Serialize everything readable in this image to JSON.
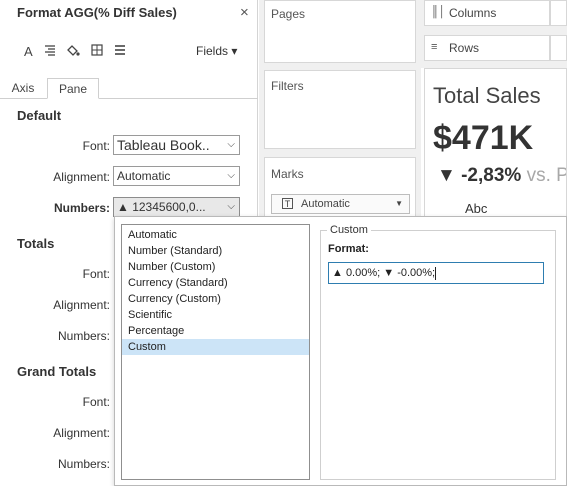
{
  "format_pane": {
    "title": "Format AGG(% Diff Sales)",
    "close": "×",
    "fields_label": "Fields ▾",
    "tabs": [
      "Axis",
      "Pane"
    ],
    "default": {
      "heading": "Default",
      "font_label": "Font:",
      "font_value": "Tableau Book..",
      "alignment_label": "Alignment:",
      "alignment_value": "Automatic",
      "numbers_label": "Numbers:",
      "numbers_value": "▲ 12345600,0..."
    },
    "totals": {
      "heading": "Totals",
      "font_label": "Font:",
      "alignment_label": "Alignment:",
      "numbers_label": "Numbers:"
    },
    "grand_totals": {
      "heading": "Grand Totals",
      "font_label": "Font:",
      "alignment_label": "Alignment:",
      "numbers_label": "Numbers:"
    }
  },
  "shelves": {
    "pages": "Pages",
    "filters": "Filters",
    "marks": "Marks",
    "marks_type": "Automatic",
    "columns": "Columns",
    "rows": "Rows"
  },
  "viz": {
    "title": "Total Sales",
    "value": "$471K",
    "change": "▼ -2,83%",
    "vs": "vs. P",
    "abc": "Abc"
  },
  "number_format": {
    "options": [
      "Automatic",
      "Number (Standard)",
      "Number (Custom)",
      "Currency (Standard)",
      "Currency (Custom)",
      "Scientific",
      "Percentage",
      "Custom"
    ],
    "selected": "Custom",
    "custom_legend": "Custom",
    "format_label": "Format:",
    "format_value": "▲ 0.00%; ▼ -0.00%;"
  }
}
